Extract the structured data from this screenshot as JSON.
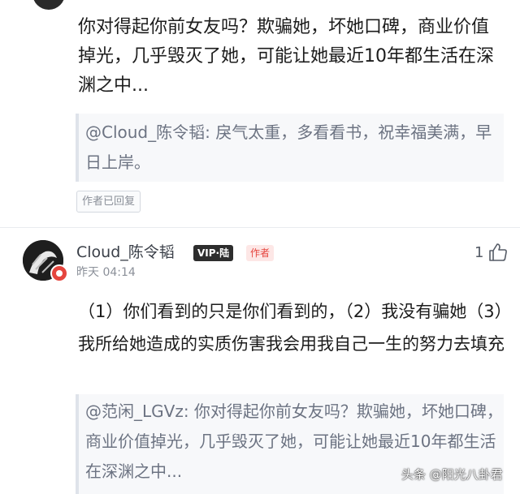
{
  "comment_1": {
    "text": "你对得起你前女友吗？欺骗她，坏她口碑，商业价值掉光，几乎毁灭了她，可能让她最近10年都生活在深渊之中...",
    "quoted_reply": {
      "author": "@Cloud_陈令韬",
      "text": ": 戾气太重，多看看书，祝幸福美满，早日上岸。"
    },
    "reply_badge": "作者已回复"
  },
  "comment_2": {
    "username": "Cloud_陈令韬",
    "vip_badge": "VIP·陆",
    "author_badge": "作者",
    "timestamp": "昨天 04:14",
    "like_count": "1",
    "text": "（1）你们看到的只是你们看到的，（2）我没有骗她（3）我所给她造成的实质伤害我会用我自己一生的努力去填充",
    "quoted_reply": {
      "author": "@范闲_LGVz",
      "text": ": 你对得起你前女友吗？欺骗她，坏她口碑，商业价值掉光，几乎毁灭了她，可能让她最近10年都生活在深渊之中..."
    }
  },
  "watermark": "头条 @阳光八卦君",
  "icons": [
    "thumbs-up-icon",
    "avatar-badge-icon"
  ],
  "colors": {
    "author_badge": "#e5453e",
    "quote_text": "#6c7382",
    "quote_bg": "#f7f8fa"
  }
}
